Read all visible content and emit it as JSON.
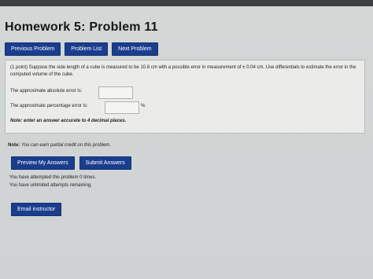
{
  "page": {
    "title": "Homework 5: Problem 11"
  },
  "nav": {
    "previous_label": "Previous Problem",
    "list_label": "Problem List",
    "next_label": "Next Problem"
  },
  "problem": {
    "statement": "(1 point) Suppose the side length of a cube is measured to be 10.8 cm with a possible error in measurement of ± 0.04 cm. Use differentials to estimate the error in the computed volume of the cube.",
    "abs_error_label": "The approximate absolute error is:",
    "abs_error_value": "",
    "pct_error_label": "The approximate percentage error is:",
    "pct_error_value": "",
    "pct_unit": "%",
    "accuracy_note": "Note: enter an answer accurate to 4 decimal places."
  },
  "footer": {
    "credit_note_prefix": "Note:",
    "credit_note_text": "You can earn partial credit on this problem.",
    "preview_label": "Preview My Answers",
    "submit_label": "Submit Answers",
    "attempts_text": "You have attempted this problem 0 times.",
    "unlimited_text": "You have unlimited attempts remaining.",
    "email_label": "Email instructor"
  },
  "colors": {
    "button_bg": "#1b3d8e",
    "button_text": "#ffffff"
  }
}
